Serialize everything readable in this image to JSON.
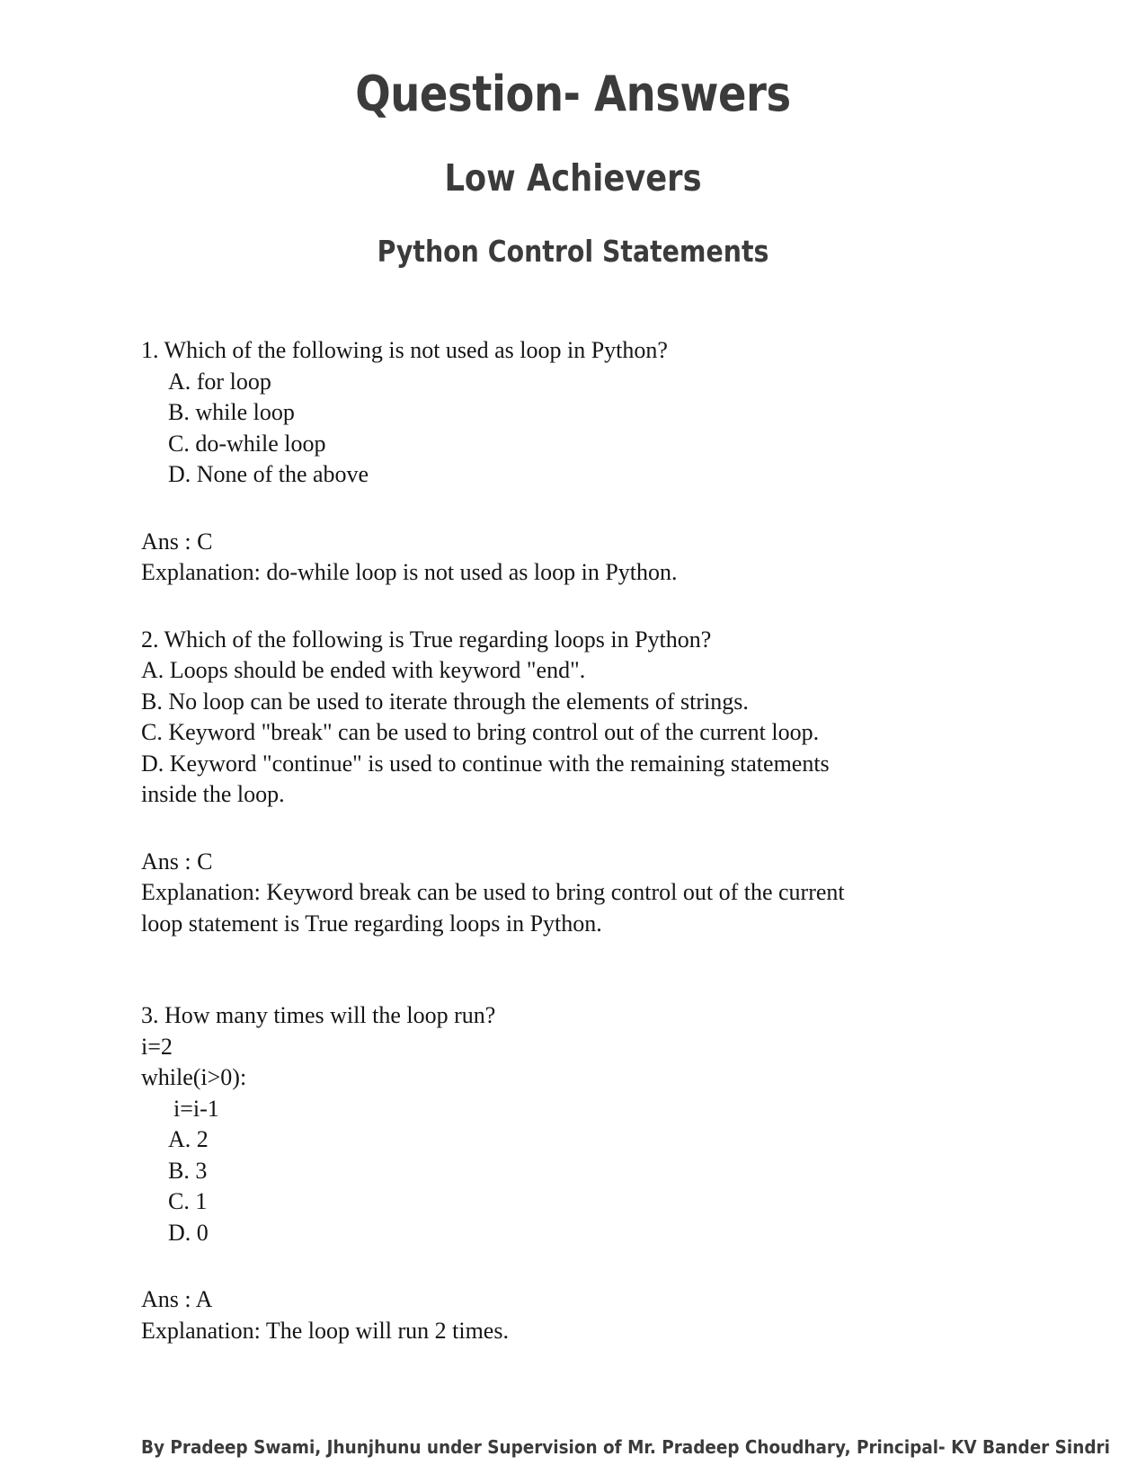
{
  "document": {
    "title": "Question- Answers",
    "subtitle": "Low Achievers",
    "topic": "Python Control Statements"
  },
  "questions": [
    {
      "number": "1.",
      "prompt": "1. Which of the following is not used as loop in Python?",
      "options": [
        "A. for loop",
        "B. while loop",
        "C. do-while loop",
        "D. None of the above"
      ],
      "answer": "Ans : C",
      "explanation": [
        "Explanation: do-while loop is not used as loop in Python."
      ]
    },
    {
      "number": "2.",
      "prompt": "2. Which of the following is True regarding loops in Python?",
      "options": [
        "A. Loops should be ended with keyword \"end\".",
        "B. No loop can be used to iterate through the elements of strings.",
        "C. Keyword \"break\" can be used to bring control out of the current loop.",
        "D. Keyword \"continue\" is used to continue with the remaining statements",
        "inside the loop."
      ],
      "answer": "Ans : C",
      "explanation": [
        "Explanation: Keyword break can be used to bring control out of the current",
        "loop statement is True regarding loops in Python."
      ]
    },
    {
      "number": "3.",
      "prompt": "3. How many times will the loop run?",
      "code": [
        "i=2",
        "while(i>0):",
        "i=i-1"
      ],
      "options": [
        "A. 2",
        "B. 3",
        "C. 1",
        "D. 0"
      ],
      "answer": "Ans : A",
      "explanation": [
        "Explanation: The loop will run 2 times."
      ]
    }
  ],
  "footer": {
    "credit": "By Pradeep Swami, Jhunjhunu  under Supervision of Mr. Pradeep Choudhary, Principal- KV Bander Sindri"
  },
  "colors": {
    "heading": "#3b3b3b",
    "body": "#151515",
    "background": "#ffffff"
  }
}
